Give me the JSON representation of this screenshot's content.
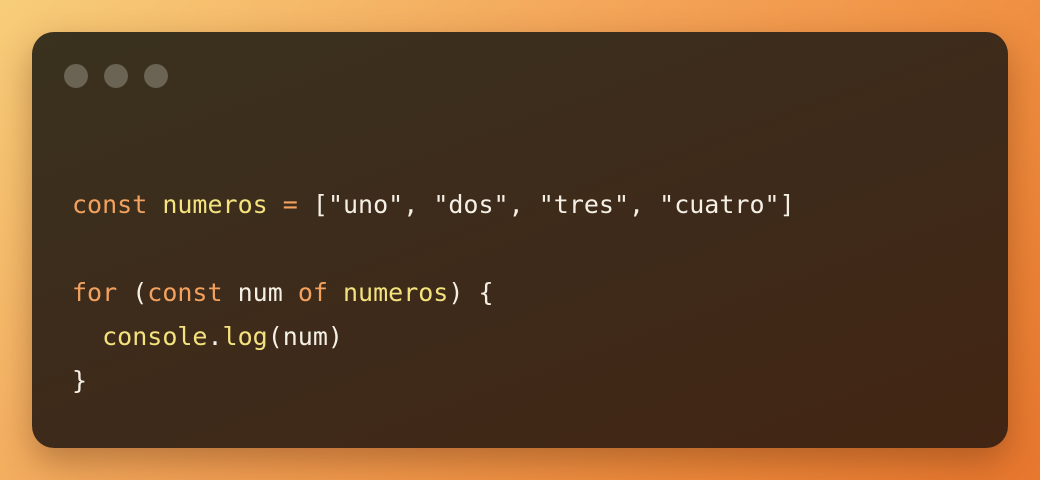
{
  "window": {
    "controls": [
      "dot",
      "dot",
      "dot"
    ]
  },
  "code": {
    "line1": {
      "kw_const": "const",
      "var_numeros": "numeros",
      "op_assign": "=",
      "bracket_open": "[",
      "str_uno": "\"uno\"",
      "comma1": ",",
      "str_dos": "\"dos\"",
      "comma2": ",",
      "str_tres": "\"tres\"",
      "comma3": ",",
      "str_cuatro": "\"cuatro\"",
      "bracket_close": "]"
    },
    "line3": {
      "kw_for": "for",
      "paren_open": "(",
      "kw_const": "const",
      "id_num": "num",
      "kw_of": "of",
      "var_numeros": "numeros",
      "paren_close": ")",
      "brace_open": "{"
    },
    "line4": {
      "indent": "  ",
      "fn_console": "console",
      "dot": ".",
      "fn_log": "log",
      "paren_open": "(",
      "id_num": "num",
      "paren_close": ")"
    },
    "line5": {
      "brace_close": "}"
    }
  },
  "colors": {
    "background_gradient_start": "#f7cd7a",
    "background_gradient_end": "#e8772e",
    "window_bg": "#3e2a1a",
    "keyword": "#f2a15f",
    "variable": "#f4e27e",
    "text": "#f5f0e6",
    "control_dot": "#6b6353"
  }
}
